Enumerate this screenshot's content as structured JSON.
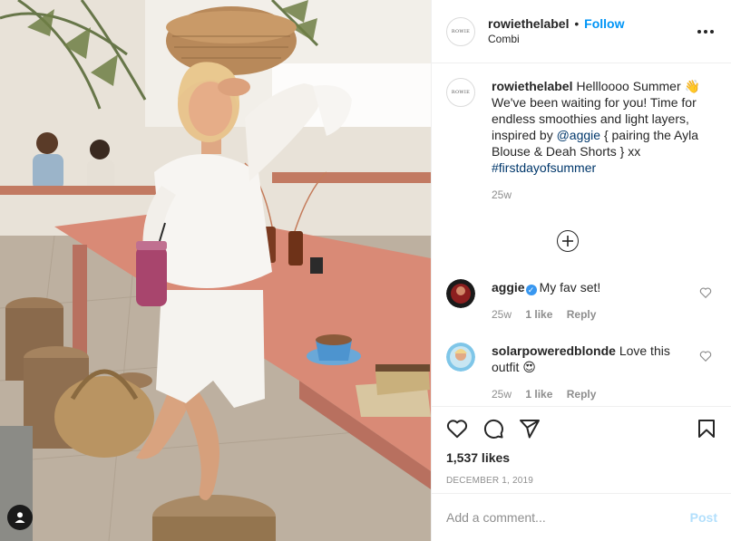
{
  "post": {
    "account": {
      "username": "rowiethelabel",
      "avatar_text": "ROWIE",
      "follow_label": "Follow",
      "separator": "•",
      "location": "Combi"
    },
    "more_icon": "more-horizontal-icon",
    "caption": {
      "username": "rowiethelabel",
      "text_before_mention": "Hellloooo Summer 👋 We've been waiting for you! Time for endless smoothies and light layers, inspired by ",
      "mention": "@aggie",
      "text_after_mention": " { pairing the Ayla Blouse & Deah Shorts } xx",
      "hashtag": "#firstdayofsummer",
      "age": "25w"
    },
    "load_more_icon": "plus-circle-icon",
    "comments": [
      {
        "username": "aggie",
        "verified": true,
        "text": "My fav set!",
        "age": "25w",
        "likes": "1 like",
        "reply_label": "Reply"
      },
      {
        "username": "solarpoweredblonde",
        "verified": false,
        "text": "Love this outfit 😍",
        "age": "25w",
        "likes": "1 like",
        "reply_label": "Reply"
      }
    ],
    "likes_count": "1,537 likes",
    "date": "DECEMBER 1, 2019",
    "add_comment": {
      "placeholder": "Add a comment...",
      "post_label": "Post"
    },
    "icons": {
      "like": "heart-icon",
      "comment": "comment-icon",
      "share": "send-icon",
      "save": "bookmark-icon",
      "tag": "user-tag-icon"
    },
    "colors": {
      "link_blue": "#0095f6",
      "muted": "#8e8e8e",
      "text": "#262626",
      "post_disabled": "#b2dffc",
      "verified_blue": "#3897f0"
    }
  }
}
